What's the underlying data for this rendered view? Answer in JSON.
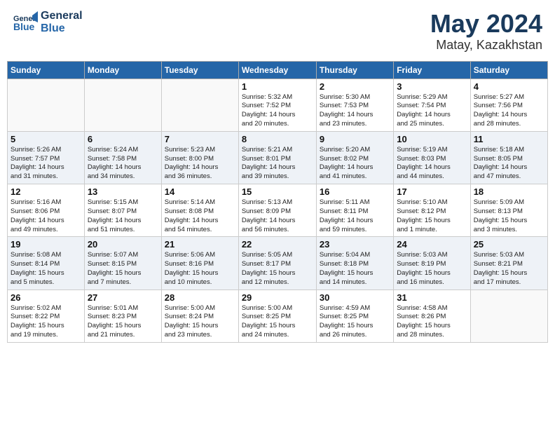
{
  "header": {
    "logo_line1": "General",
    "logo_line2": "Blue",
    "month_year": "May 2024",
    "location": "Matay, Kazakhstan"
  },
  "weekdays": [
    "Sunday",
    "Monday",
    "Tuesday",
    "Wednesday",
    "Thursday",
    "Friday",
    "Saturday"
  ],
  "weeks": [
    [
      {
        "day": "",
        "info": ""
      },
      {
        "day": "",
        "info": ""
      },
      {
        "day": "",
        "info": ""
      },
      {
        "day": "1",
        "info": "Sunrise: 5:32 AM\nSunset: 7:52 PM\nDaylight: 14 hours\nand 20 minutes."
      },
      {
        "day": "2",
        "info": "Sunrise: 5:30 AM\nSunset: 7:53 PM\nDaylight: 14 hours\nand 23 minutes."
      },
      {
        "day": "3",
        "info": "Sunrise: 5:29 AM\nSunset: 7:54 PM\nDaylight: 14 hours\nand 25 minutes."
      },
      {
        "day": "4",
        "info": "Sunrise: 5:27 AM\nSunset: 7:56 PM\nDaylight: 14 hours\nand 28 minutes."
      }
    ],
    [
      {
        "day": "5",
        "info": "Sunrise: 5:26 AM\nSunset: 7:57 PM\nDaylight: 14 hours\nand 31 minutes."
      },
      {
        "day": "6",
        "info": "Sunrise: 5:24 AM\nSunset: 7:58 PM\nDaylight: 14 hours\nand 34 minutes."
      },
      {
        "day": "7",
        "info": "Sunrise: 5:23 AM\nSunset: 8:00 PM\nDaylight: 14 hours\nand 36 minutes."
      },
      {
        "day": "8",
        "info": "Sunrise: 5:21 AM\nSunset: 8:01 PM\nDaylight: 14 hours\nand 39 minutes."
      },
      {
        "day": "9",
        "info": "Sunrise: 5:20 AM\nSunset: 8:02 PM\nDaylight: 14 hours\nand 41 minutes."
      },
      {
        "day": "10",
        "info": "Sunrise: 5:19 AM\nSunset: 8:03 PM\nDaylight: 14 hours\nand 44 minutes."
      },
      {
        "day": "11",
        "info": "Sunrise: 5:18 AM\nSunset: 8:05 PM\nDaylight: 14 hours\nand 47 minutes."
      }
    ],
    [
      {
        "day": "12",
        "info": "Sunrise: 5:16 AM\nSunset: 8:06 PM\nDaylight: 14 hours\nand 49 minutes."
      },
      {
        "day": "13",
        "info": "Sunrise: 5:15 AM\nSunset: 8:07 PM\nDaylight: 14 hours\nand 51 minutes."
      },
      {
        "day": "14",
        "info": "Sunrise: 5:14 AM\nSunset: 8:08 PM\nDaylight: 14 hours\nand 54 minutes."
      },
      {
        "day": "15",
        "info": "Sunrise: 5:13 AM\nSunset: 8:09 PM\nDaylight: 14 hours\nand 56 minutes."
      },
      {
        "day": "16",
        "info": "Sunrise: 5:11 AM\nSunset: 8:11 PM\nDaylight: 14 hours\nand 59 minutes."
      },
      {
        "day": "17",
        "info": "Sunrise: 5:10 AM\nSunset: 8:12 PM\nDaylight: 15 hours\nand 1 minute."
      },
      {
        "day": "18",
        "info": "Sunrise: 5:09 AM\nSunset: 8:13 PM\nDaylight: 15 hours\nand 3 minutes."
      }
    ],
    [
      {
        "day": "19",
        "info": "Sunrise: 5:08 AM\nSunset: 8:14 PM\nDaylight: 15 hours\nand 5 minutes."
      },
      {
        "day": "20",
        "info": "Sunrise: 5:07 AM\nSunset: 8:15 PM\nDaylight: 15 hours\nand 7 minutes."
      },
      {
        "day": "21",
        "info": "Sunrise: 5:06 AM\nSunset: 8:16 PM\nDaylight: 15 hours\nand 10 minutes."
      },
      {
        "day": "22",
        "info": "Sunrise: 5:05 AM\nSunset: 8:17 PM\nDaylight: 15 hours\nand 12 minutes."
      },
      {
        "day": "23",
        "info": "Sunrise: 5:04 AM\nSunset: 8:18 PM\nDaylight: 15 hours\nand 14 minutes."
      },
      {
        "day": "24",
        "info": "Sunrise: 5:03 AM\nSunset: 8:19 PM\nDaylight: 15 hours\nand 16 minutes."
      },
      {
        "day": "25",
        "info": "Sunrise: 5:03 AM\nSunset: 8:21 PM\nDaylight: 15 hours\nand 17 minutes."
      }
    ],
    [
      {
        "day": "26",
        "info": "Sunrise: 5:02 AM\nSunset: 8:22 PM\nDaylight: 15 hours\nand 19 minutes."
      },
      {
        "day": "27",
        "info": "Sunrise: 5:01 AM\nSunset: 8:23 PM\nDaylight: 15 hours\nand 21 minutes."
      },
      {
        "day": "28",
        "info": "Sunrise: 5:00 AM\nSunset: 8:24 PM\nDaylight: 15 hours\nand 23 minutes."
      },
      {
        "day": "29",
        "info": "Sunrise: 5:00 AM\nSunset: 8:25 PM\nDaylight: 15 hours\nand 24 minutes."
      },
      {
        "day": "30",
        "info": "Sunrise: 4:59 AM\nSunset: 8:25 PM\nDaylight: 15 hours\nand 26 minutes."
      },
      {
        "day": "31",
        "info": "Sunrise: 4:58 AM\nSunset: 8:26 PM\nDaylight: 15 hours\nand 28 minutes."
      },
      {
        "day": "",
        "info": ""
      }
    ]
  ]
}
